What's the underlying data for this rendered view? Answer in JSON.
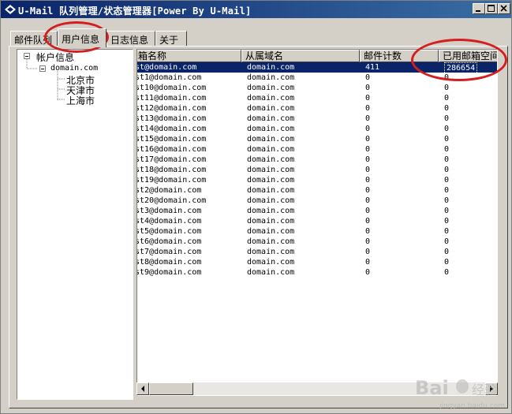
{
  "window": {
    "title": "U-Mail 队列管理/状态管理器[Power By U-Mail]"
  },
  "tabs": [
    {
      "label": "邮件队列",
      "active": false
    },
    {
      "label": "用户信息",
      "active": true
    },
    {
      "label": "日志信息",
      "active": false
    },
    {
      "label": "关于",
      "active": false
    }
  ],
  "tree": {
    "root": "帐户信息",
    "domain": "domain.com",
    "children": [
      "北京市",
      "天津市",
      "上海市"
    ]
  },
  "table": {
    "columns": [
      "箱名称",
      "从属域名",
      "邮件计数",
      "已用邮箱空间"
    ],
    "rows": [
      [
        "st@domain.com",
        "domain.com",
        "411",
        "286654"
      ],
      [
        "st1@domain.com",
        "domain.com",
        "0",
        "0"
      ],
      [
        "st10@domain.com",
        "domain.com",
        "0",
        "0"
      ],
      [
        "st11@domain.com",
        "domain.com",
        "0",
        "0"
      ],
      [
        "st12@domain.com",
        "domain.com",
        "0",
        "0"
      ],
      [
        "st13@domain.com",
        "domain.com",
        "0",
        "0"
      ],
      [
        "st14@domain.com",
        "domain.com",
        "0",
        "0"
      ],
      [
        "st15@domain.com",
        "domain.com",
        "0",
        "0"
      ],
      [
        "st16@domain.com",
        "domain.com",
        "0",
        "0"
      ],
      [
        "st17@domain.com",
        "domain.com",
        "0",
        "0"
      ],
      [
        "st18@domain.com",
        "domain.com",
        "0",
        "0"
      ],
      [
        "st19@domain.com",
        "domain.com",
        "0",
        "0"
      ],
      [
        "st2@domain.com",
        "domain.com",
        "0",
        "0"
      ],
      [
        "st20@domain.com",
        "domain.com",
        "0",
        "0"
      ],
      [
        "st3@domain.com",
        "domain.com",
        "0",
        "0"
      ],
      [
        "st4@domain.com",
        "domain.com",
        "0",
        "0"
      ],
      [
        "st5@domain.com",
        "domain.com",
        "0",
        "0"
      ],
      [
        "st6@domain.com",
        "domain.com",
        "0",
        "0"
      ],
      [
        "st7@domain.com",
        "domain.com",
        "0",
        "0"
      ],
      [
        "st8@domain.com",
        "domain.com",
        "0",
        "0"
      ],
      [
        "st9@domain.com",
        "domain.com",
        "0",
        "0"
      ]
    ],
    "selected_row": 0
  },
  "annotation_color": "#d41f1f",
  "selection_color": "#0a246a",
  "watermark": {
    "text": "jingyan.baidu.com"
  }
}
